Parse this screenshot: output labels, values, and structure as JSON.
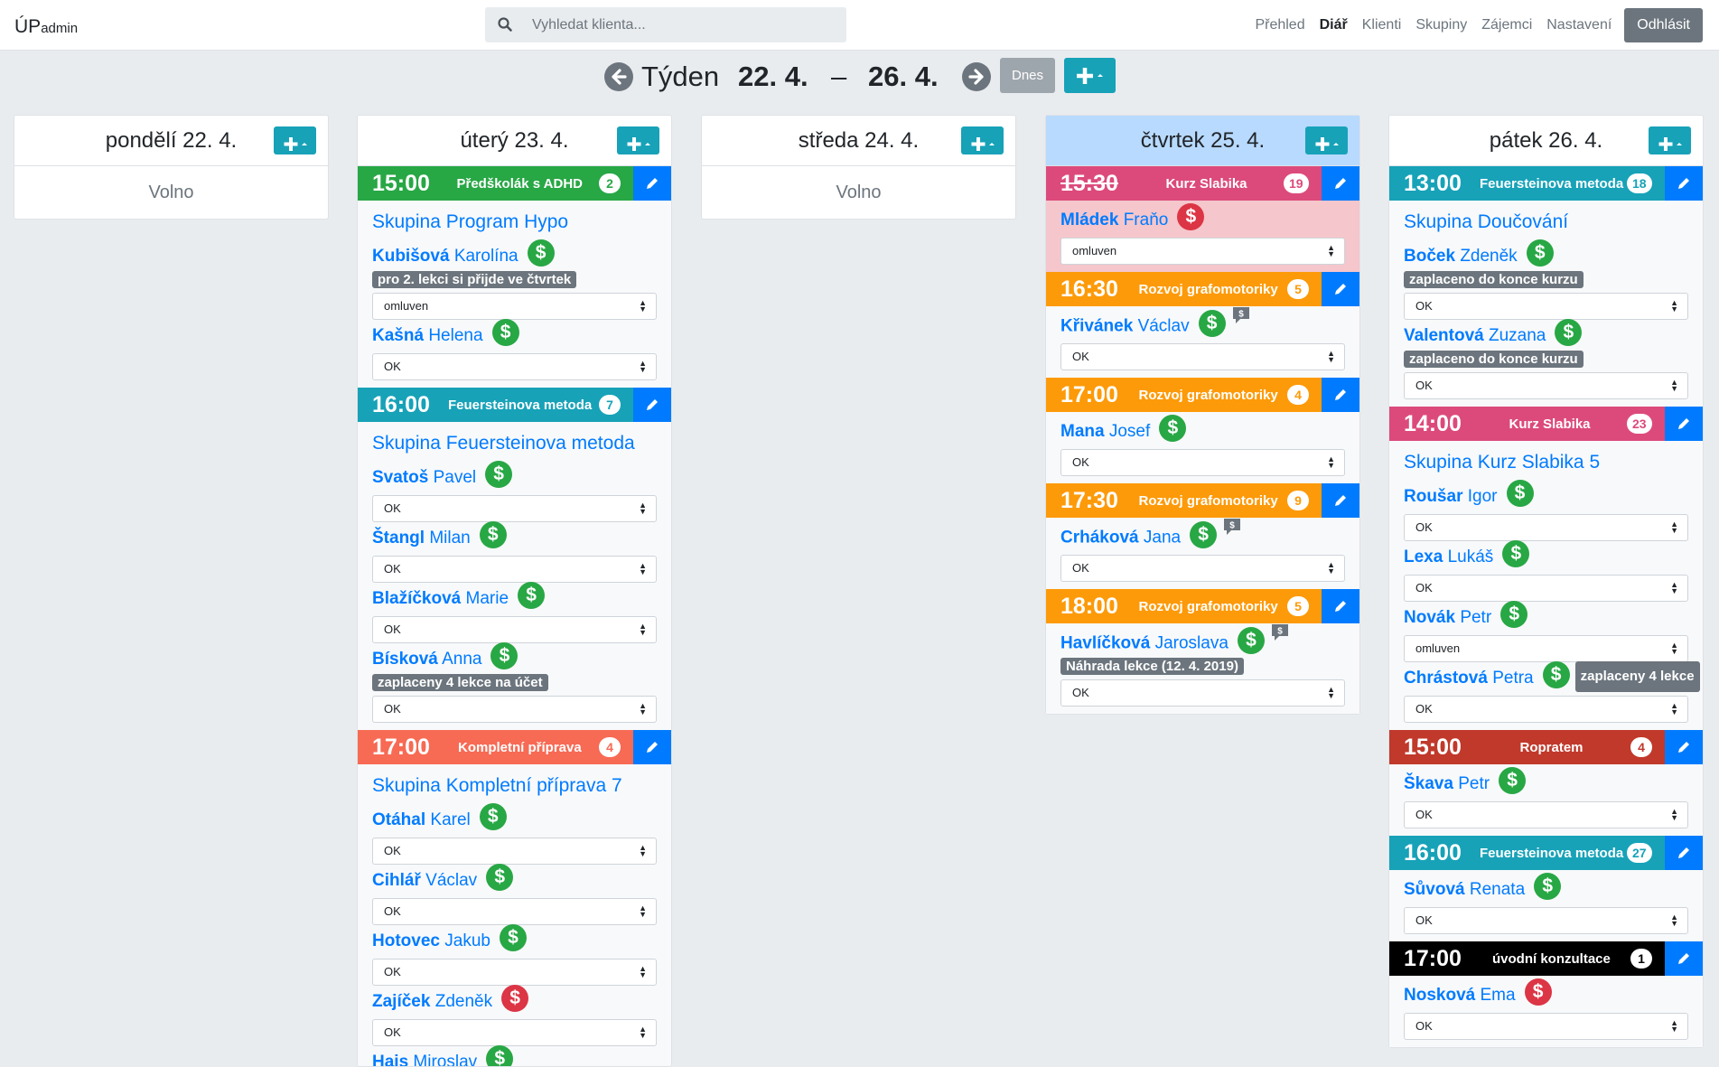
{
  "app": {
    "brand": "ÚP",
    "brand_sub": "admin"
  },
  "search": {
    "placeholder": "Vyhledat klienta..."
  },
  "nav": {
    "items": [
      "Přehled",
      "Diář",
      "Klienti",
      "Skupiny",
      "Zájemci",
      "Nastavení"
    ],
    "active": "Diář",
    "logout": "Odhlásit"
  },
  "week": {
    "label": "Týden",
    "start": "22. 4.",
    "dash": "–",
    "end": "26. 4.",
    "today_label": "Dnes",
    "add_label": "+"
  },
  "icons": {
    "search": "search-icon",
    "prev": "arrow-left-circle-icon",
    "next": "arrow-right-circle-icon",
    "edit": "pencil-icon",
    "paid": "dollar-circle-icon",
    "comment": "comment-icon",
    "plus": "plus-dropdown-icon"
  },
  "colors": {
    "green": "#28a745",
    "red": "#dc3545",
    "teal": "#17a2b8",
    "pink": "#dc4a7c",
    "orange": "#fd9a09",
    "salmon": "#f76a54",
    "darkred": "#c0392b",
    "black": "#000000",
    "blue": "#007bff",
    "today": "#b8daff"
  },
  "days": [
    {
      "title": "pondělí 22. 4.",
      "today": false,
      "free": "Volno",
      "lessons": []
    },
    {
      "title": "úterý 23. 4.",
      "today": false,
      "lessons": [
        {
          "time": "15:00",
          "name": "Předškolák s ADHD",
          "count": "2",
          "color": "#28a745",
          "group": "Skupina Program Hypo",
          "clients": [
            {
              "last": "Kubišová",
              "first": "Karolína",
              "paid": "g",
              "note": "pro 2. lekci si přijde ve čtvrtek",
              "status": "omluven"
            },
            {
              "last": "Kašná",
              "first": "Helena",
              "paid": "g",
              "status": "OK"
            }
          ]
        },
        {
          "time": "16:00",
          "name": "Feuersteinova metoda",
          "count": "7",
          "color": "#17a2b8",
          "group": "Skupina Feuersteinova metoda",
          "clients": [
            {
              "last": "Svatoš",
              "first": "Pavel",
              "paid": "g",
              "status": "OK"
            },
            {
              "last": "Štangl",
              "first": "Milan",
              "paid": "g",
              "status": "OK"
            },
            {
              "last": "Blažíčková",
              "first": "Marie",
              "paid": "g",
              "status": "OK"
            },
            {
              "last": "Bísková",
              "first": "Anna",
              "paid": "g",
              "note": "zaplaceny 4 lekce na účet",
              "status": "OK"
            }
          ]
        },
        {
          "time": "17:00",
          "name": "Kompletní příprava",
          "count": "4",
          "color": "#f76a54",
          "group": "Skupina Kompletní příprava 7",
          "clients": [
            {
              "last": "Otáhal",
              "first": "Karel",
              "paid": "g",
              "status": "OK"
            },
            {
              "last": "Cihlář",
              "first": "Václav",
              "paid": "g",
              "status": "OK"
            },
            {
              "last": "Hotovec",
              "first": "Jakub",
              "paid": "g",
              "status": "OK"
            },
            {
              "last": "Zajíček",
              "first": "Zdeněk",
              "paid": "r",
              "status": "OK"
            },
            {
              "last": "Hais",
              "first": "Miroslav",
              "paid": "g",
              "status": ""
            }
          ]
        }
      ]
    },
    {
      "title": "středa 24. 4.",
      "today": false,
      "free": "Volno",
      "lessons": []
    },
    {
      "title": "čtvrtek 25. 4.",
      "today": true,
      "lessons": [
        {
          "time": "15:30",
          "name": "Kurz Slabika",
          "count": "19",
          "color": "#dc4a7c",
          "strike": true,
          "pink": true,
          "clients": [
            {
              "last": "Mládek",
              "first": "Fraňo",
              "paid": "r",
              "status": "omluven"
            }
          ]
        },
        {
          "time": "16:30",
          "name": "Rozvoj grafomotoriky",
          "count": "5",
          "color": "#fd9a09",
          "clients": [
            {
              "last": "Křivánek",
              "first": "Václav",
              "paid": "g",
              "comment": true,
              "status": "OK"
            }
          ]
        },
        {
          "time": "17:00",
          "name": "Rozvoj grafomotoriky",
          "count": "4",
          "color": "#fd9a09",
          "clients": [
            {
              "last": "Mana",
              "first": "Josef",
              "paid": "g",
              "status": "OK"
            }
          ]
        },
        {
          "time": "17:30",
          "name": "Rozvoj grafomotoriky",
          "count": "9",
          "color": "#fd9a09",
          "clients": [
            {
              "last": "Crháková",
              "first": "Jana",
              "paid": "g",
              "comment": true,
              "status": "OK"
            }
          ]
        },
        {
          "time": "18:00",
          "name": "Rozvoj grafomotoriky",
          "count": "5",
          "color": "#fd9a09",
          "clients": [
            {
              "last": "Havlíčková",
              "first": "Jaroslava",
              "paid": "g",
              "comment": true,
              "note": "Náhrada lekce (12. 4. 2019)",
              "status": "OK"
            }
          ]
        }
      ]
    },
    {
      "title": "pátek 26. 4.",
      "today": false,
      "lessons": [
        {
          "time": "13:00",
          "name": "Feuersteinova metoda",
          "count": "18",
          "color": "#17a2b8",
          "group": "Skupina Doučování",
          "clients": [
            {
              "last": "Boček",
              "first": "Zdeněk",
              "paid": "g",
              "note": "zaplaceno do konce kurzu",
              "status": "OK"
            },
            {
              "last": "Valentová",
              "first": "Zuzana",
              "paid": "g",
              "note": "zaplaceno do konce kurzu",
              "status": "OK"
            }
          ]
        },
        {
          "time": "14:00",
          "name": "Kurz Slabika",
          "count": "23",
          "color": "#dc4a7c",
          "group": "Skupina Kurz Slabika 5",
          "clients": [
            {
              "last": "Roušar",
              "first": "Igor",
              "paid": "g",
              "status": "OK"
            },
            {
              "last": "Lexa",
              "first": "Lukáš",
              "paid": "g",
              "status": "OK"
            },
            {
              "last": "Novák",
              "first": "Petr",
              "paid": "g",
              "status": "omluven"
            },
            {
              "last": "Chrástová",
              "first": "Petra",
              "paid": "g",
              "inline_note": "zaplaceny 4 lekce",
              "status": "OK"
            }
          ]
        },
        {
          "time": "15:00",
          "name": "Ropratem",
          "count": "4",
          "color": "#c0392b",
          "clients": [
            {
              "last": "Škava",
              "first": "Petr",
              "paid": "g",
              "status": "OK"
            }
          ]
        },
        {
          "time": "16:00",
          "name": "Feuersteinova metoda",
          "count": "27",
          "color": "#17a2b8",
          "clients": [
            {
              "last": "Sůvová",
              "first": "Renata",
              "paid": "g",
              "status": "OK"
            }
          ]
        },
        {
          "time": "17:00",
          "name": "úvodní konzultace",
          "count": "1",
          "color": "#000000",
          "clients": [
            {
              "last": "Nosková",
              "first": "Ema",
              "paid": "r",
              "status": "OK"
            }
          ]
        }
      ]
    }
  ]
}
